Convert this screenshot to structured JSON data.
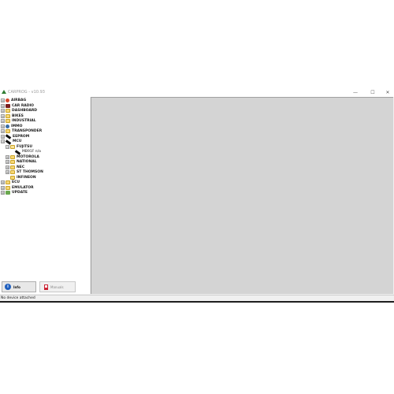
{
  "window": {
    "title": "CARPROG - v10.93",
    "controls": {
      "minimize": "—",
      "maximize": "☐",
      "close": "✕"
    }
  },
  "tree": {
    "items": [
      {
        "label": "AIRBAG",
        "icon": "airbag-icon",
        "expander": "⊕",
        "level": 0
      },
      {
        "label": "CAR RADIO",
        "icon": "car-radio-icon",
        "expander": "⊕",
        "level": 0
      },
      {
        "label": "DASHBOARD",
        "icon": "folder-icon",
        "expander": "⊕",
        "level": 0
      },
      {
        "label": "BIKES",
        "icon": "folder-icon",
        "expander": "⊕",
        "level": 0
      },
      {
        "label": "INDUSTRIAL",
        "icon": "folder-icon",
        "expander": "⊕",
        "level": 0
      },
      {
        "label": "IMMO",
        "icon": "immo-icon",
        "expander": "⊕",
        "level": 0
      },
      {
        "label": "TRANSPONDER",
        "icon": "folder-icon",
        "expander": "⊕",
        "level": 0
      },
      {
        "label": "EEPROM",
        "icon": "chip-icon",
        "expander": "⊕",
        "level": 0
      },
      {
        "label": "MCU",
        "icon": "chip-icon",
        "expander": "⊖",
        "level": 0
      },
      {
        "label": "FUJITSU",
        "icon": "open-folder-icon",
        "expander": "⊖",
        "level": 1
      },
      {
        "label": "MB91F n/a",
        "icon": "chip-icon",
        "expander": "",
        "level": 2
      },
      {
        "label": "MOTOROLA",
        "icon": "folder-icon",
        "expander": "⊞",
        "level": 1
      },
      {
        "label": "NATIONAL",
        "icon": "folder-icon",
        "expander": "⊞",
        "level": 1
      },
      {
        "label": "NEC",
        "icon": "folder-icon",
        "expander": "⊞",
        "level": 1
      },
      {
        "label": "ST THOMSON",
        "icon": "folder-icon",
        "expander": "⊞",
        "level": 1
      },
      {
        "label": "INFINEON",
        "icon": "folder-icon",
        "expander": "",
        "level": 1
      },
      {
        "label": "ECU",
        "icon": "folder-icon",
        "expander": "⊞",
        "level": 0
      },
      {
        "label": "EMULATOR",
        "icon": "folder-icon",
        "expander": "⊞",
        "level": 0
      },
      {
        "label": "UPDATE",
        "icon": "update-icon",
        "expander": "⊞",
        "level": 0
      }
    ]
  },
  "buttons": {
    "info_label": "Info",
    "info_icon_glyph": "i",
    "manuals_label": "Manuals"
  },
  "status": {
    "text": "No device attached"
  }
}
